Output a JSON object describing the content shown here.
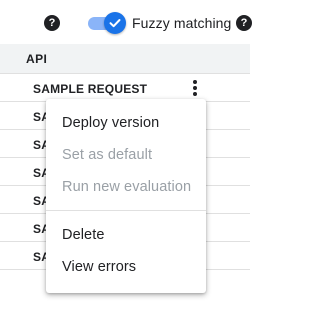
{
  "toolbar": {
    "fuzzy_label": "Fuzzy matching",
    "fuzzy_enabled": true,
    "help_glyph": "?"
  },
  "table": {
    "header_api": "API",
    "rows": [
      {
        "api": "SAMPLE REQUEST"
      },
      {
        "api": "SA"
      },
      {
        "api": "SA"
      },
      {
        "api": "SA"
      },
      {
        "api": "SA"
      },
      {
        "api": "SA"
      },
      {
        "api": "SA"
      }
    ]
  },
  "menu": {
    "items": [
      {
        "label": "Deploy version",
        "disabled": false
      },
      {
        "label": "Set as default",
        "disabled": true
      },
      {
        "label": "Run new evaluation",
        "disabled": true
      },
      {
        "label": "Delete",
        "disabled": false
      },
      {
        "label": "View errors",
        "disabled": false
      }
    ]
  },
  "colors": {
    "accent": "#1a73e8",
    "accent_track": "#8ab4f8",
    "disabled_text": "#9aa0a6",
    "header_bg": "#f1f3f4"
  },
  "icons": {
    "help": "help-circle-icon",
    "toggle_check": "check-icon",
    "row_menu": "more-vert-icon"
  }
}
